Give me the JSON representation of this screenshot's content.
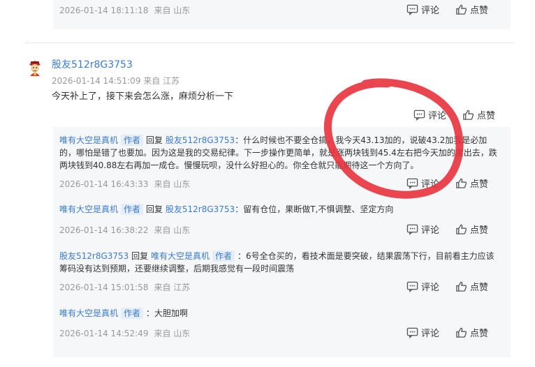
{
  "top_reply": {
    "time": "2026-01-14 18:11:18",
    "from": "来自 山东",
    "comment_label": "评论",
    "like_label": "点赞"
  },
  "post": {
    "username": "股友512r8G3753",
    "time": "2026-01-14 14:51:09",
    "from": "来自 江苏",
    "text": "今天补上了，接下来会怎么涨，麻烦分析一下",
    "comment_label": "评论",
    "like_label": "点赞"
  },
  "replies": [
    {
      "user": "唯有大空是真机",
      "tag": "作者",
      "reply_word": "回复",
      "target": "股友512r8G3753",
      "text": "：什么时候也不要全仓搞，我今天43.13加的，说破43.2加我是必加的，哪怕是错了也要加。因为这是我的交易纪律。下一步操作更简单，就是涨两块钱到45.4左右把今天加的卖出去，跌两块钱到40.88左右再加一成仓。慢慢玩呗，没什么好担心的。你全仓就只能期待这一个方向了。",
      "time": "2026-01-14 16:43:33",
      "from": "来自 山东",
      "comment_label": "评论",
      "like_label": "点赞"
    },
    {
      "user": "唯有大空是真机",
      "tag": "作者",
      "reply_word": "回复",
      "target": "股友512r8G3753",
      "text": "：留有仓位，果断做T,不惧调整、坚定方向",
      "time": "2026-01-14 16:38:22",
      "from": "来自 山东",
      "comment_label": "评论",
      "like_label": "点赞"
    },
    {
      "user": "股友512r8G3753",
      "tag": "",
      "reply_word": "回复",
      "target": "唯有大空是真机",
      "target_tag": "作者",
      "text": "：6号全仓买的，看技术面是要突破，结果震荡下行，目前看主力应该筹码没有达到预期，还要继续调整，后期我感觉有一段时间震荡",
      "time": "2026-01-14 15:01:58",
      "from": "来自 江苏",
      "comment_label": "评论",
      "like_label": "点赞"
    },
    {
      "user": "唯有大空是真机",
      "tag": "作者",
      "text": "：大胆加啊",
      "time": "2026-01-14 14:52:49",
      "from": "来自 山东",
      "comment_label": "评论",
      "like_label": "点赞"
    }
  ],
  "colors": {
    "link": "#3a7bd5",
    "reply_bg": "#f6f7f9",
    "annotation": "#e8323c"
  },
  "icons": {
    "comment": "comment-icon",
    "like": "thumbs-up-icon",
    "avatar": "god-of-wealth-avatar"
  }
}
